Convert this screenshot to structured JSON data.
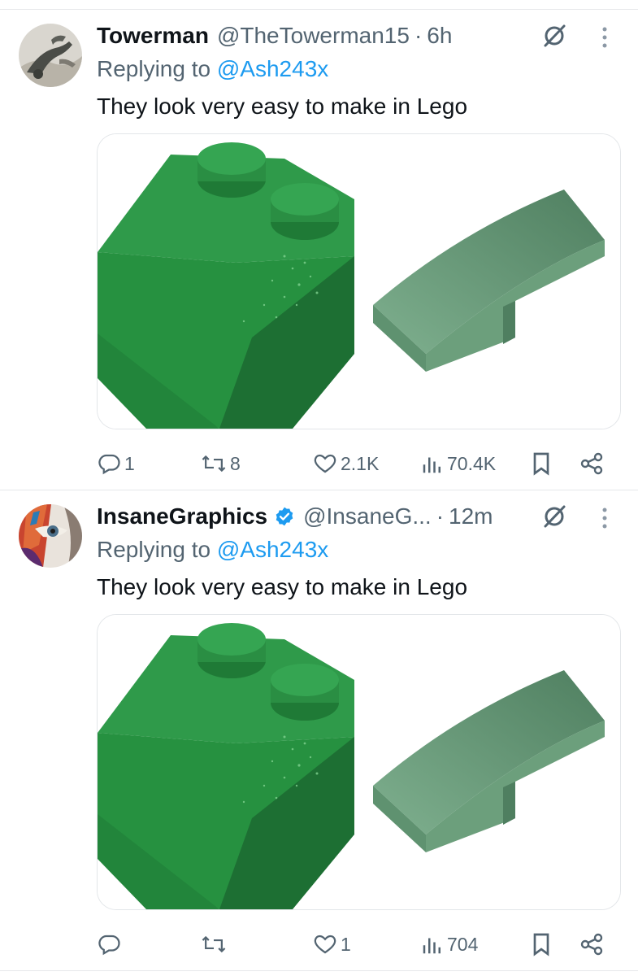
{
  "tweets": [
    {
      "name": "Towerman",
      "handle": "@TheTowerman15",
      "separator": "·",
      "time": "6h",
      "verified": false,
      "replying_label": "Replying to",
      "replying_to": "@Ash243x",
      "text": "They look very easy to make in Lego",
      "media": [
        "green-lego-slope-brick",
        "sand-green-curved-slope-tile"
      ],
      "stats": {
        "replies": "1",
        "retweets": "8",
        "likes": "2.1K",
        "views": "70.4K"
      }
    },
    {
      "name": "InsaneGraphics",
      "handle": "@InsaneG...",
      "separator": "·",
      "time": "12m",
      "verified": true,
      "replying_label": "Replying to",
      "replying_to": "@Ash243x",
      "text": "They look very easy to make in Lego",
      "media": [
        "green-lego-slope-brick",
        "sand-green-curved-slope-tile"
      ],
      "stats": {
        "replies": "",
        "retweets": "",
        "likes": "1",
        "views": "704"
      }
    }
  ],
  "icons": {
    "reply": "reply-icon",
    "retweet": "retweet-icon",
    "like": "heart-icon",
    "views": "views-chart-icon",
    "bookmark": "bookmark-icon",
    "share": "share-icon",
    "grok": "grok-icon",
    "more": "more-vertical-icon",
    "verified": "verified-badge-icon"
  },
  "colors": {
    "text": "#0f1419",
    "secondary": "#536471",
    "link": "#1d9bf0",
    "verified": "#1d9bf0",
    "divider": "#e6e8ea",
    "brick_green": "#2e8b45",
    "tile_sand_green": "#6aa07e"
  }
}
